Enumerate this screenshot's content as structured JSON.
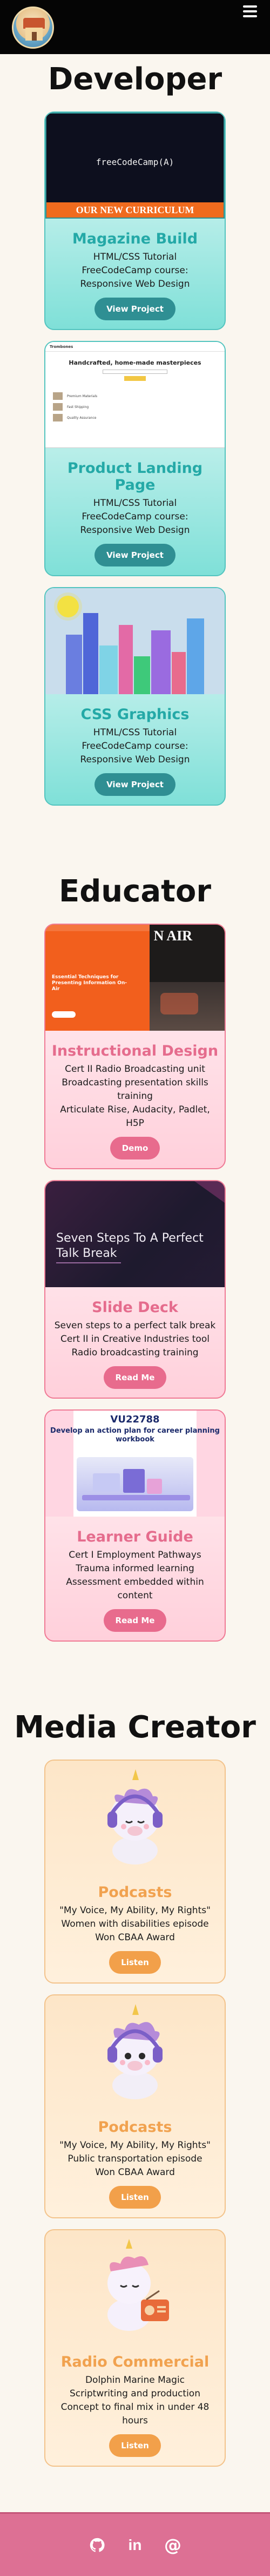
{
  "nav": {
    "menu_icon": "hamburger-menu-icon",
    "logo_icon": "house-logo-icon"
  },
  "colors": {
    "developer_accent": "#24a9a7",
    "educator_accent": "#e56c8d",
    "media_accent": "#f1a24f",
    "footer": "#dd7094"
  },
  "developer": {
    "title": "Developer",
    "cards": [
      {
        "title": "Magazine Build",
        "lines": [
          "HTML/CSS Tutorial",
          "FreeCodeCamp course:",
          "Responsive Web Design"
        ],
        "button": "View Project",
        "thumb_mono": "freeCodeCamp(A)",
        "thumb_strip": "OUR NEW CURRICULUM"
      },
      {
        "title": "Product Landing Page",
        "lines": [
          "HTML/CSS Tutorial",
          "FreeCodeCamp course:",
          "Responsive Web Design"
        ],
        "button": "View Project",
        "thumb_nav": "Trombones",
        "thumb_hero": "Handcrafted, home-made masterpieces",
        "thumb_features": [
          "Premium Materials",
          "Fast Shipping",
          "Quality Assurance"
        ]
      },
      {
        "title": "CSS Graphics",
        "lines": [
          "HTML/CSS Tutorial",
          "FreeCodeCamp course:",
          "Responsive Web Design"
        ],
        "button": "View Project"
      }
    ]
  },
  "educator": {
    "title": "Educator",
    "cards": [
      {
        "title": "Instructional Design",
        "lines": [
          "Cert II Radio Broadcasting unit",
          "Broadcasting presentation skills training",
          "Articulate Rise, Audacity, Padlet, H5P"
        ],
        "button": "Demo",
        "thumb_text": "Essential Techniques for Presenting Information On-Air",
        "thumb_big": "N AIR"
      },
      {
        "title": "Slide Deck",
        "lines": [
          "Seven steps to a perfect talk break",
          "Cert II in Creative Industries tool",
          "Radio broadcasting training"
        ],
        "button": "Read Me",
        "thumb_text": "Seven Steps To A Perfect Talk Break"
      },
      {
        "title": "Learner Guide",
        "lines": [
          "Cert I Employment Pathways",
          "Trauma informed learning",
          "Assessment embedded within content"
        ],
        "button": "Read Me",
        "thumb_code": "VU22788",
        "thumb_title": "Develop an action plan for career planning workbook"
      }
    ]
  },
  "media": {
    "title": "Media Creator",
    "cards": [
      {
        "title": "Podcasts",
        "lines": [
          "\"My Voice, My Ability, My Rights\"",
          "Women with disabilities episode",
          "Won CBAA Award"
        ],
        "button": "Listen",
        "art": "unicorn-headphones-icon"
      },
      {
        "title": "Podcasts",
        "lines": [
          "\"My Voice, My Ability, My Rights\"",
          "Public transportation episode",
          "Won CBAA Award"
        ],
        "button": "Listen",
        "art": "unicorn-headphones-icon"
      },
      {
        "title": "Radio Commercial",
        "lines": [
          "Dolphin Marine Magic",
          "Scriptwriting and production",
          "Concept to final mix in under 48 hours"
        ],
        "button": "Listen",
        "art": "unicorn-radio-icon"
      }
    ]
  },
  "footer": {
    "icons": [
      "github-icon",
      "linkedin-icon",
      "email-at-icon"
    ],
    "linkedin_text": "in",
    "at_text": "@"
  }
}
